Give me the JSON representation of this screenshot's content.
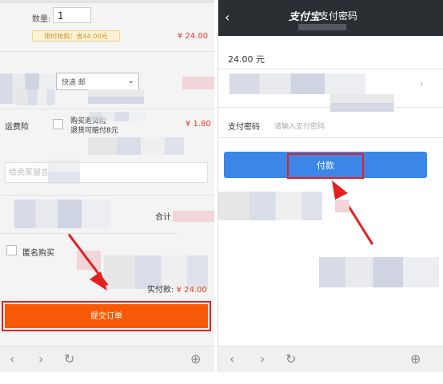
{
  "order": {
    "quantity_label": "数量:",
    "quantity_value": "1",
    "promo_badge": "限时抢购：省44.00元",
    "item_price": "¥ 24.00",
    "shipping_insurance_label": "运费险",
    "shipping_insurance_desc_line1": "购买退货险",
    "shipping_insurance_desc_line2": "退货可赔付8元",
    "shipping_insurance_price": "¥ 1.80",
    "message_placeholder": "给卖家留言",
    "total_label": "合计",
    "anonymous_label": "匿名购买",
    "actual_pay_label": "实付款: ",
    "actual_pay_value": "¥ 24.00",
    "submit_button": "提交订单",
    "shipping_method": "快递 邮"
  },
  "payment": {
    "logo_text": "支付宝",
    "title": "支付密码",
    "amount": "24.00 元",
    "password_label": "支付密码",
    "password_placeholder": "请输入支付密码",
    "pay_button": "付款"
  },
  "nav": {
    "back": "‹",
    "forward": "›",
    "refresh": "↻",
    "add": "⊕"
  },
  "colors": {
    "submit_orange": "#f75a07",
    "pay_blue": "#3b86e6",
    "highlight_red": "#e4201e",
    "price_red": "#e23c2c",
    "header_dark": "#2b2e33"
  }
}
